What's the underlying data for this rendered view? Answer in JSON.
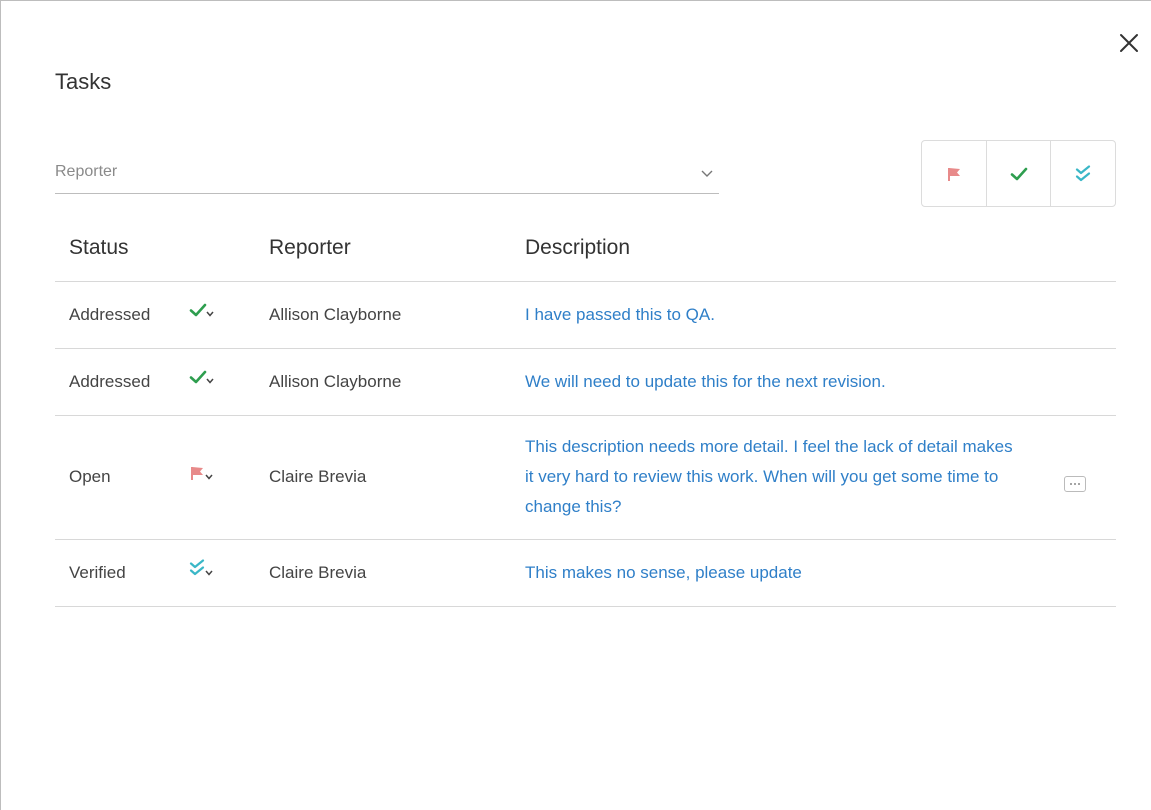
{
  "dialog": {
    "title": "Tasks",
    "close_icon": "close-icon"
  },
  "filters": {
    "reporter_placeholder": "Reporter",
    "buttons": [
      {
        "name": "open",
        "icon": "flag-icon",
        "color": "#e88a8a"
      },
      {
        "name": "addressed",
        "icon": "check-icon",
        "color": "#2e9e4f"
      },
      {
        "name": "verified",
        "icon": "double-check-icon",
        "color": "#3ab7c7"
      }
    ]
  },
  "table": {
    "headers": {
      "status": "Status",
      "reporter": "Reporter",
      "description": "Description"
    },
    "rows": [
      {
        "status": "Addressed",
        "status_icon": "check-icon",
        "reporter": "Allison Clayborne",
        "description": "I have passed this to QA."
      },
      {
        "status": "Addressed",
        "status_icon": "check-icon",
        "reporter": "Allison Clayborne",
        "description": "We will need to update this for the next revision."
      },
      {
        "status": "Open",
        "status_icon": "flag-icon",
        "reporter": "Claire Brevia",
        "description": "This description needs more detail. I feel the lack of detail makes it very hard to review this work. When will you get some time to change this?"
      },
      {
        "status": "Verified",
        "status_icon": "double-check-icon",
        "reporter": "Claire Brevia",
        "description": "This makes no sense, please update"
      }
    ]
  },
  "colors": {
    "link": "#2f7fc8",
    "check": "#2e9e4f",
    "flag": "#e88a8a",
    "verified": "#3ab7c7"
  }
}
